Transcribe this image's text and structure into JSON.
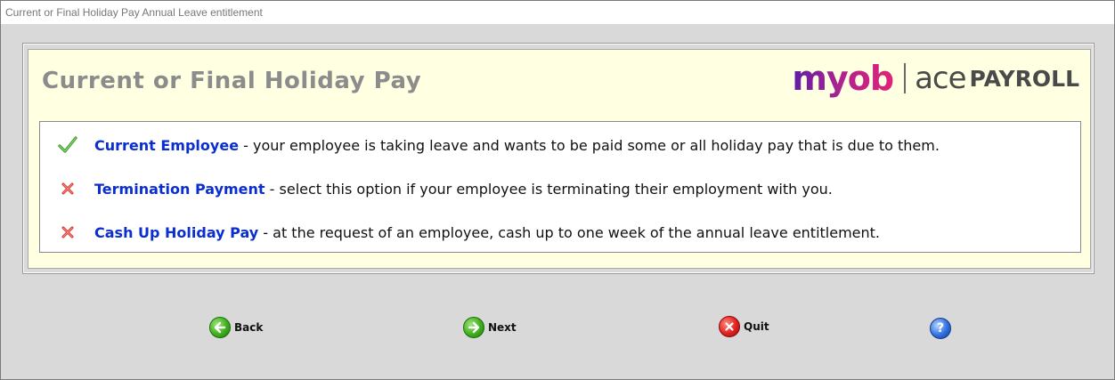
{
  "window": {
    "title": "Current or Final Holiday Pay Annual Leave entitlement"
  },
  "header": {
    "heading": "Current or Final Holiday Pay",
    "logo": {
      "brand": "myob",
      "product_prefix": "ace",
      "product_name": "PAYROLL"
    }
  },
  "options": [
    {
      "title": "Current Employee",
      "description": " - your employee is taking leave and wants to be paid some or all holiday pay that is due to them.",
      "status_icon": "checkmark-icon",
      "selected": true
    },
    {
      "title": "Termination Payment",
      "description": " - select this option if your employee is terminating their employment with you.",
      "status_icon": "x-mark-icon",
      "selected": false
    },
    {
      "title": "Cash Up Holiday Pay",
      "description": " - at the request of an employee, cash up to one week of the annual leave entitlement.",
      "status_icon": "x-mark-icon",
      "selected": false
    }
  ],
  "buttons": {
    "back": "Back",
    "next": "Next",
    "quit": "Quit",
    "help_icon": "help-icon"
  },
  "colors": {
    "panel_background": "#ffffe1",
    "option_title": "#0b2ecf",
    "heading": "#8c8c8c"
  }
}
